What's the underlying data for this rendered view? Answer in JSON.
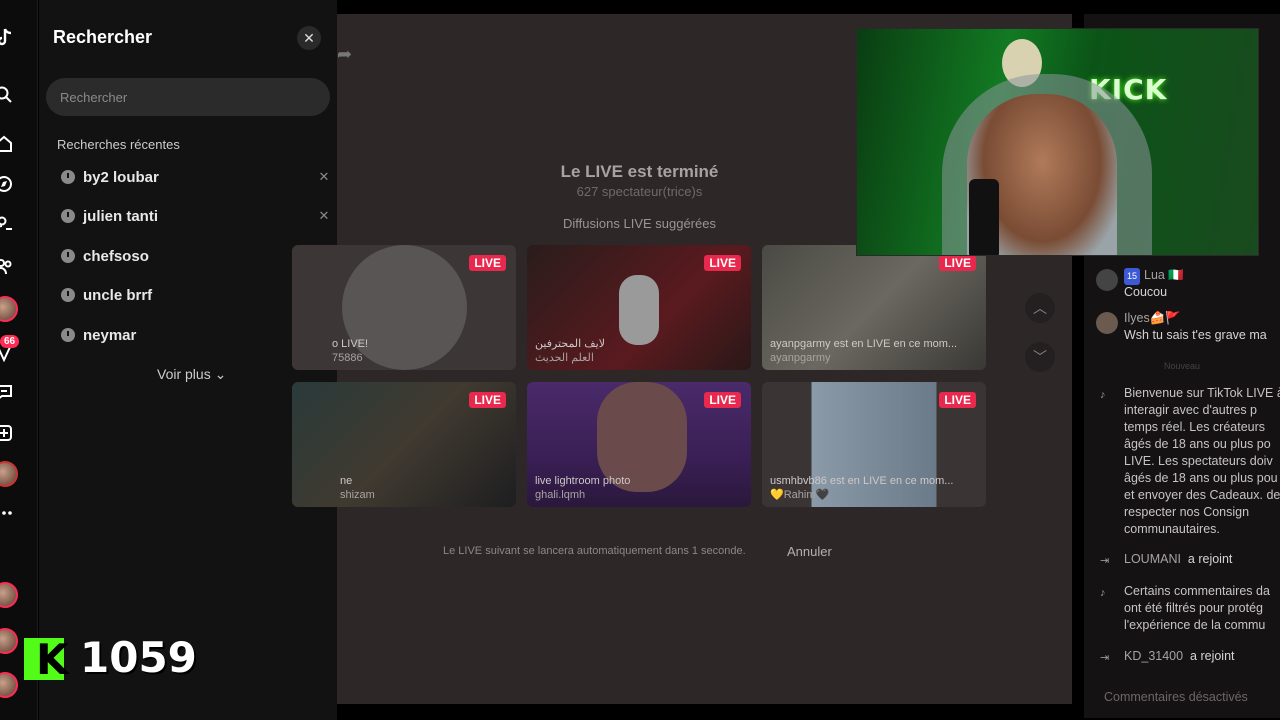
{
  "search": {
    "title": "Rechercher",
    "placeholder": "Rechercher",
    "recent_title": "Recherches récentes",
    "recent": [
      "by2 loubar",
      "julien tanti",
      "chefsoso",
      "uncle brrf",
      "neymar"
    ],
    "see_more": "Voir plus ⌄",
    "close_glyph": "✕",
    "remove_glyph": "✕"
  },
  "rail": {
    "notification_badge": "66",
    "icons": [
      "tiktok-logo-icon",
      "search-icon",
      "home-icon",
      "explore-icon",
      "following-icon",
      "friends-icon",
      "live-icon",
      "messages-icon",
      "upload-icon",
      "profile-icon",
      "more-icon"
    ]
  },
  "live": {
    "ended_title": "Le LIVE est terminé",
    "viewers": "627 spectateur(trice)s",
    "suggested_title": "Diffusions LIVE suggérées",
    "badge": "LIVE",
    "cards": [
      {
        "caption": "o LIVE!",
        "user": "75886"
      },
      {
        "caption": "لايف المحترفين",
        "user": "العلم الحديث"
      },
      {
        "caption": "ayanpgarmy est en LIVE en ce mom...",
        "user": "ayanpgarmy"
      },
      {
        "caption": "ne",
        "user": "shizam"
      },
      {
        "caption": "live lightroom photo",
        "user": "ghali.lqmh"
      },
      {
        "caption": "usmhbvb86 est en LIVE en ce mom...",
        "user": "💛Rahim🖤"
      }
    ],
    "next_notice": "Le LIVE suivant se lancera automatiquement dans 1 seconde.",
    "cancel": "Annuler"
  },
  "chat": {
    "messages": [
      {
        "name": "Lua 🇮🇹",
        "level": "15",
        "text": "Coucou"
      },
      {
        "name": "Ilyes🍰🚩",
        "text": "Wsh tu sais t'es grave ma"
      }
    ],
    "new_label": "Nouveau",
    "system_welcome": "Bienvenue sur TikTok LIVE à interagir avec d'autres p temps réel. Les créateurs âgés de 18 ans ou plus po LIVE. Les spectateurs doiv âgés de 18 ans ou plus pou et envoyer des Cadeaux. de respecter nos Consign communautaires.",
    "join1_user": "LOUMANI",
    "join1_text": "a rejoint",
    "system_filtered": "Certains commentaires da ont été filtrés pour protég l'expérience de la commu",
    "join2_user": "KD_31400",
    "join2_text": "a rejoint",
    "footer": "Commentaires désactivés"
  },
  "overlay": {
    "kick_text": "KICK",
    "k_letter": "K",
    "count": "1059"
  },
  "colors": {
    "live_red": "#e8284c",
    "kick_green": "#53fc18"
  }
}
